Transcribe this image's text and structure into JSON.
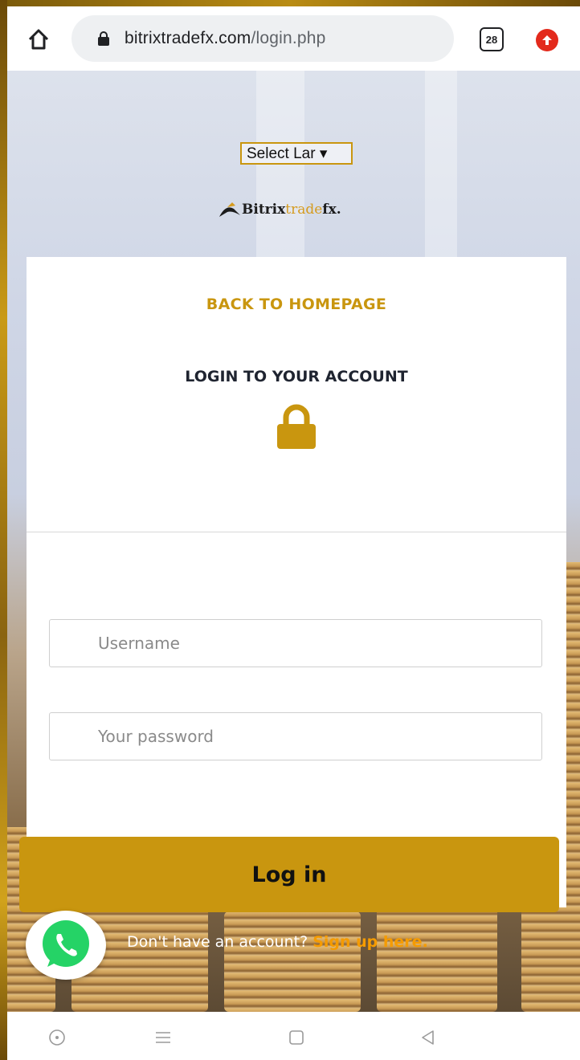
{
  "browser": {
    "url_domain": "bitrixtradefx.com",
    "url_path": "/login.php",
    "tab_count": "28",
    "icons": [
      "home-icon",
      "lock-icon",
      "tabs-icon",
      "upload-icon"
    ]
  },
  "page": {
    "language_select": "Select Lar ▾",
    "logo": {
      "part1": "Bitrix",
      "part2": "trade",
      "part3": "fx."
    },
    "back_link": "BACK TO HOMEPAGE",
    "login_title": "LOGIN TO YOUR ACCOUNT",
    "username_placeholder": "Username",
    "password_placeholder": "Your password",
    "login_button": "Log in",
    "signup_prompt": "Don't have an account?",
    "signup_link": "Sign up here."
  },
  "colors": {
    "accent": "#c9960f",
    "link_orange": "#f59b00",
    "whatsapp_green": "#25d366"
  },
  "nav": {
    "icons": [
      "circle-dot-icon",
      "menu-icon",
      "square-icon",
      "back-triangle-icon"
    ]
  }
}
